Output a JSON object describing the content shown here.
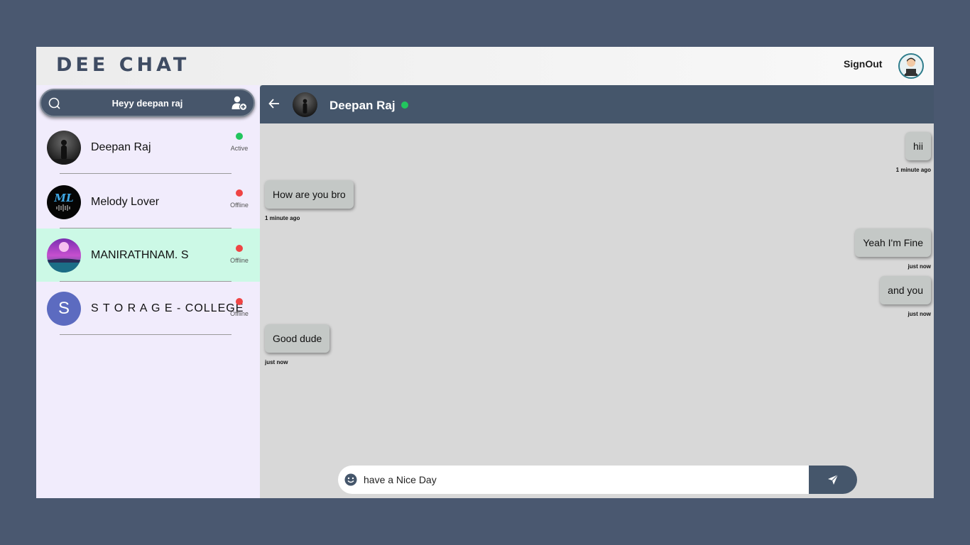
{
  "header": {
    "brand": "DEE CHAT",
    "signout_label": "SignOut"
  },
  "sidebar": {
    "search_text": "Heyy deepan raj",
    "contacts": [
      {
        "name": "Deepan Raj",
        "status": "Active",
        "status_color": "#22c55e"
      },
      {
        "name": "Melody Lover",
        "status": "Offline",
        "status_color": "#ef4444"
      },
      {
        "name": "MANIRATHNAM. S",
        "status": "Offline",
        "status_color": "#ef4444"
      },
      {
        "name": "S T O R A G E - COLLEGE",
        "status": "Offline",
        "status_color": "#ef4444",
        "initial": "S"
      }
    ]
  },
  "chat": {
    "contact_name": "Deepan Raj",
    "online_color": "#22c55e",
    "messages": [
      {
        "text": "hii",
        "time": "1 minute ago",
        "side": "right"
      },
      {
        "text": "How are you bro",
        "time": "1 minute ago",
        "side": "left"
      },
      {
        "text": "Yeah I'm Fine",
        "time": "just now",
        "side": "right"
      },
      {
        "text": "and you",
        "time": "just now",
        "side": "right"
      },
      {
        "text": "Good dude",
        "time": "just now",
        "side": "left"
      }
    ],
    "composer_value": "have a Nice Day",
    "icons": {
      "back": "arrow-left-icon",
      "emoji": "smiley-icon",
      "send": "paper-plane-icon"
    }
  },
  "colors": {
    "outer_background": "#4a5870",
    "header_accent": "#45566b",
    "selected_contact": "#ccf9e6",
    "sidebar_background": "#f1ecfc",
    "chat_background": "#d8d8d8"
  }
}
